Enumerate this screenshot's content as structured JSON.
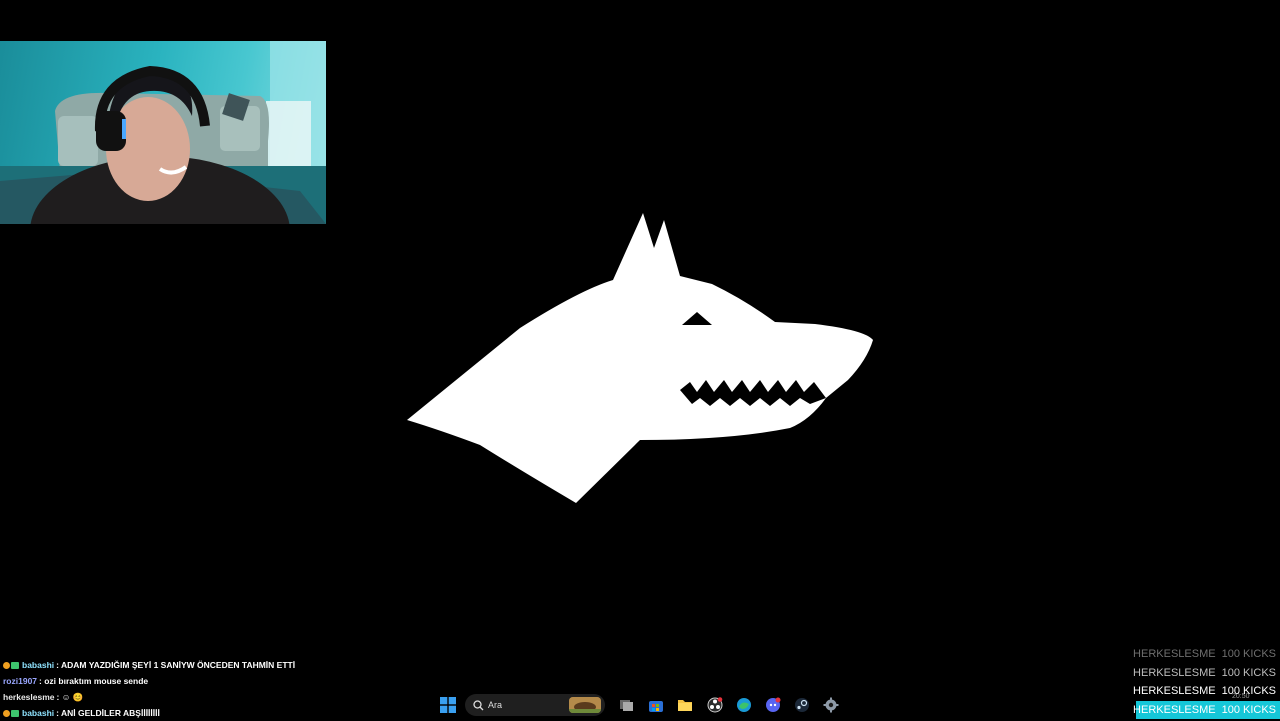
{
  "chat": {
    "messages": [
      {
        "user": "babashi",
        "text": ": ADAM YAZDIĞIM ŞEYİ 1 SANİYW ÖNCEDEN TAHMİN ETTİ",
        "user_color": "#8fe3ff",
        "badges": true
      },
      {
        "user": "rozi1907",
        "text": ": ozi bıraktım mouse sende",
        "user_color": "#9aa7ff",
        "badges": false
      },
      {
        "user": "herkeslesme",
        "text": ": ☺ 😊",
        "user_color": "#e9e9e9",
        "badges": false
      },
      {
        "user": "babashi",
        "text": ": ANİ GELDİLER ABŞİİİİİİİİ",
        "user_color": "#8fe3ff",
        "badges": true
      }
    ]
  },
  "taskbar": {
    "search_placeholder": "Ara",
    "icons": [
      "windows-start-icon",
      "search-icon",
      "task-view-icon",
      "microsoft-store-icon",
      "file-explorer-icon",
      "obs-icon",
      "edge-browser-icon",
      "discord-icon",
      "steam-icon",
      "settings-icon"
    ]
  },
  "kicks": {
    "rows": [
      {
        "name": "HERKESLESME",
        "count": "100 KICKS",
        "style": "faded"
      },
      {
        "name": "HERKESLESME",
        "count": "100 KICKS",
        "style": "mid"
      },
      {
        "name": "HERKESLESME",
        "count": "100 KICKS",
        "style": "bright"
      },
      {
        "name": "HERKESLESME",
        "count": "100 KICKS",
        "style": "highlight"
      }
    ]
  },
  "clock": {
    "time": "20:50"
  },
  "colors": {
    "accent": "#15c7d8",
    "background": "#000000",
    "logo": "#ffffff"
  }
}
